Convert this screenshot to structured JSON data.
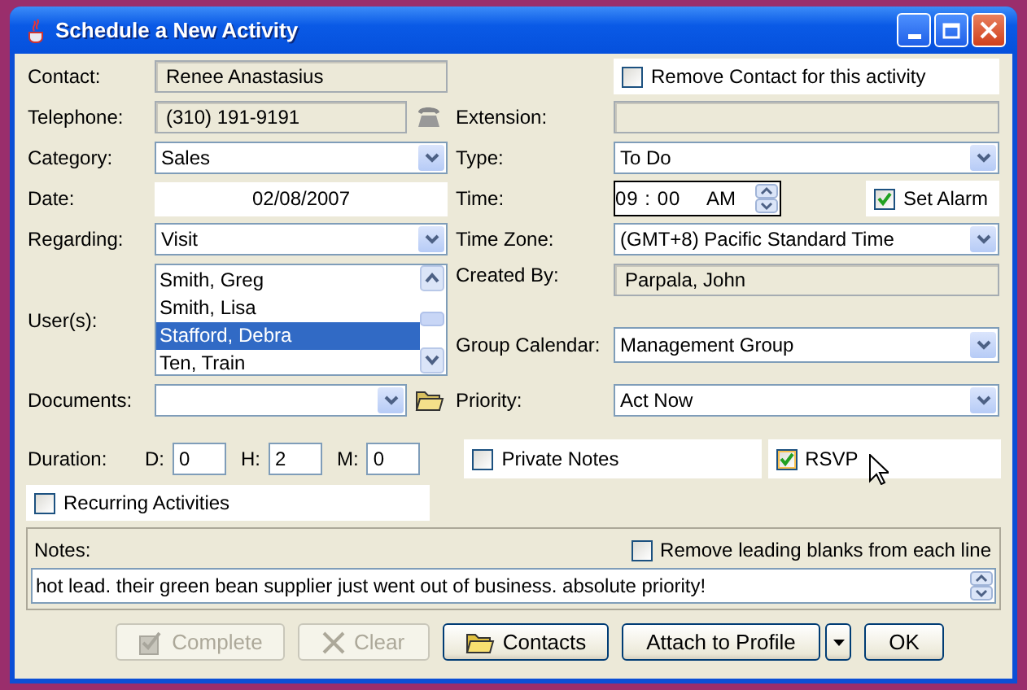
{
  "window": {
    "title": "Schedule a New Activity"
  },
  "contact": {
    "label": "Contact:",
    "value": "Renee Anastasius"
  },
  "remove_contact": {
    "label": "Remove Contact for this activity",
    "checked": false
  },
  "telephone": {
    "label": "Telephone:",
    "value": "(310) 191-9191"
  },
  "extension": {
    "label": "Extension:"
  },
  "category": {
    "label": "Category:",
    "value": "Sales"
  },
  "type": {
    "label": "Type:",
    "value": "To Do"
  },
  "date": {
    "label": "Date:",
    "value": "02/08/2007"
  },
  "time": {
    "label": "Time:",
    "value": "09 : 00",
    "period": "AM"
  },
  "set_alarm": {
    "label": "Set Alarm",
    "checked": true
  },
  "regarding": {
    "label": "Regarding:",
    "value": "Visit"
  },
  "time_zone": {
    "label": "Time Zone:",
    "value": "(GMT+8) Pacific Standard Time"
  },
  "users": {
    "label": "User(s):",
    "items": [
      {
        "name": "Smith, Greg",
        "selected": false
      },
      {
        "name": "Smith, Lisa",
        "selected": false
      },
      {
        "name": "Stafford, Debra",
        "selected": true
      },
      {
        "name": "Ten, Train",
        "selected": false
      }
    ]
  },
  "created_by": {
    "label": "Created By:",
    "value": "Parpala, John"
  },
  "group_calendar": {
    "label": "Group Calendar:",
    "value": "Management Group"
  },
  "documents": {
    "label": "Documents:"
  },
  "priority": {
    "label": "Priority:",
    "value": "Act Now"
  },
  "duration": {
    "label": "Duration:",
    "fields": [
      {
        "label": "D:",
        "value": "0"
      },
      {
        "label": "H:",
        "value": "2"
      },
      {
        "label": "M:",
        "value": "0"
      }
    ]
  },
  "private_notes": {
    "label": "Private Notes",
    "checked": false
  },
  "rsvp": {
    "label": "RSVP",
    "checked": true
  },
  "recurring": {
    "label": "Recurring Activities",
    "checked": false
  },
  "notes": {
    "label": "Notes:",
    "value": "hot lead. their green bean supplier just went out of business. absolute priority!"
  },
  "remove_blanks": {
    "label": "Remove leading blanks from each line",
    "checked": false
  },
  "buttons": [
    {
      "kind": "complete",
      "label": "Complete",
      "disabled": true
    },
    {
      "kind": "clear",
      "label": "Clear",
      "disabled": true
    },
    {
      "kind": "contacts",
      "label": "Contacts",
      "disabled": false
    },
    {
      "kind": "split",
      "label": "Attach to Profile",
      "disabled": false
    },
    {
      "kind": "default",
      "label": "OK",
      "disabled": false
    }
  ]
}
